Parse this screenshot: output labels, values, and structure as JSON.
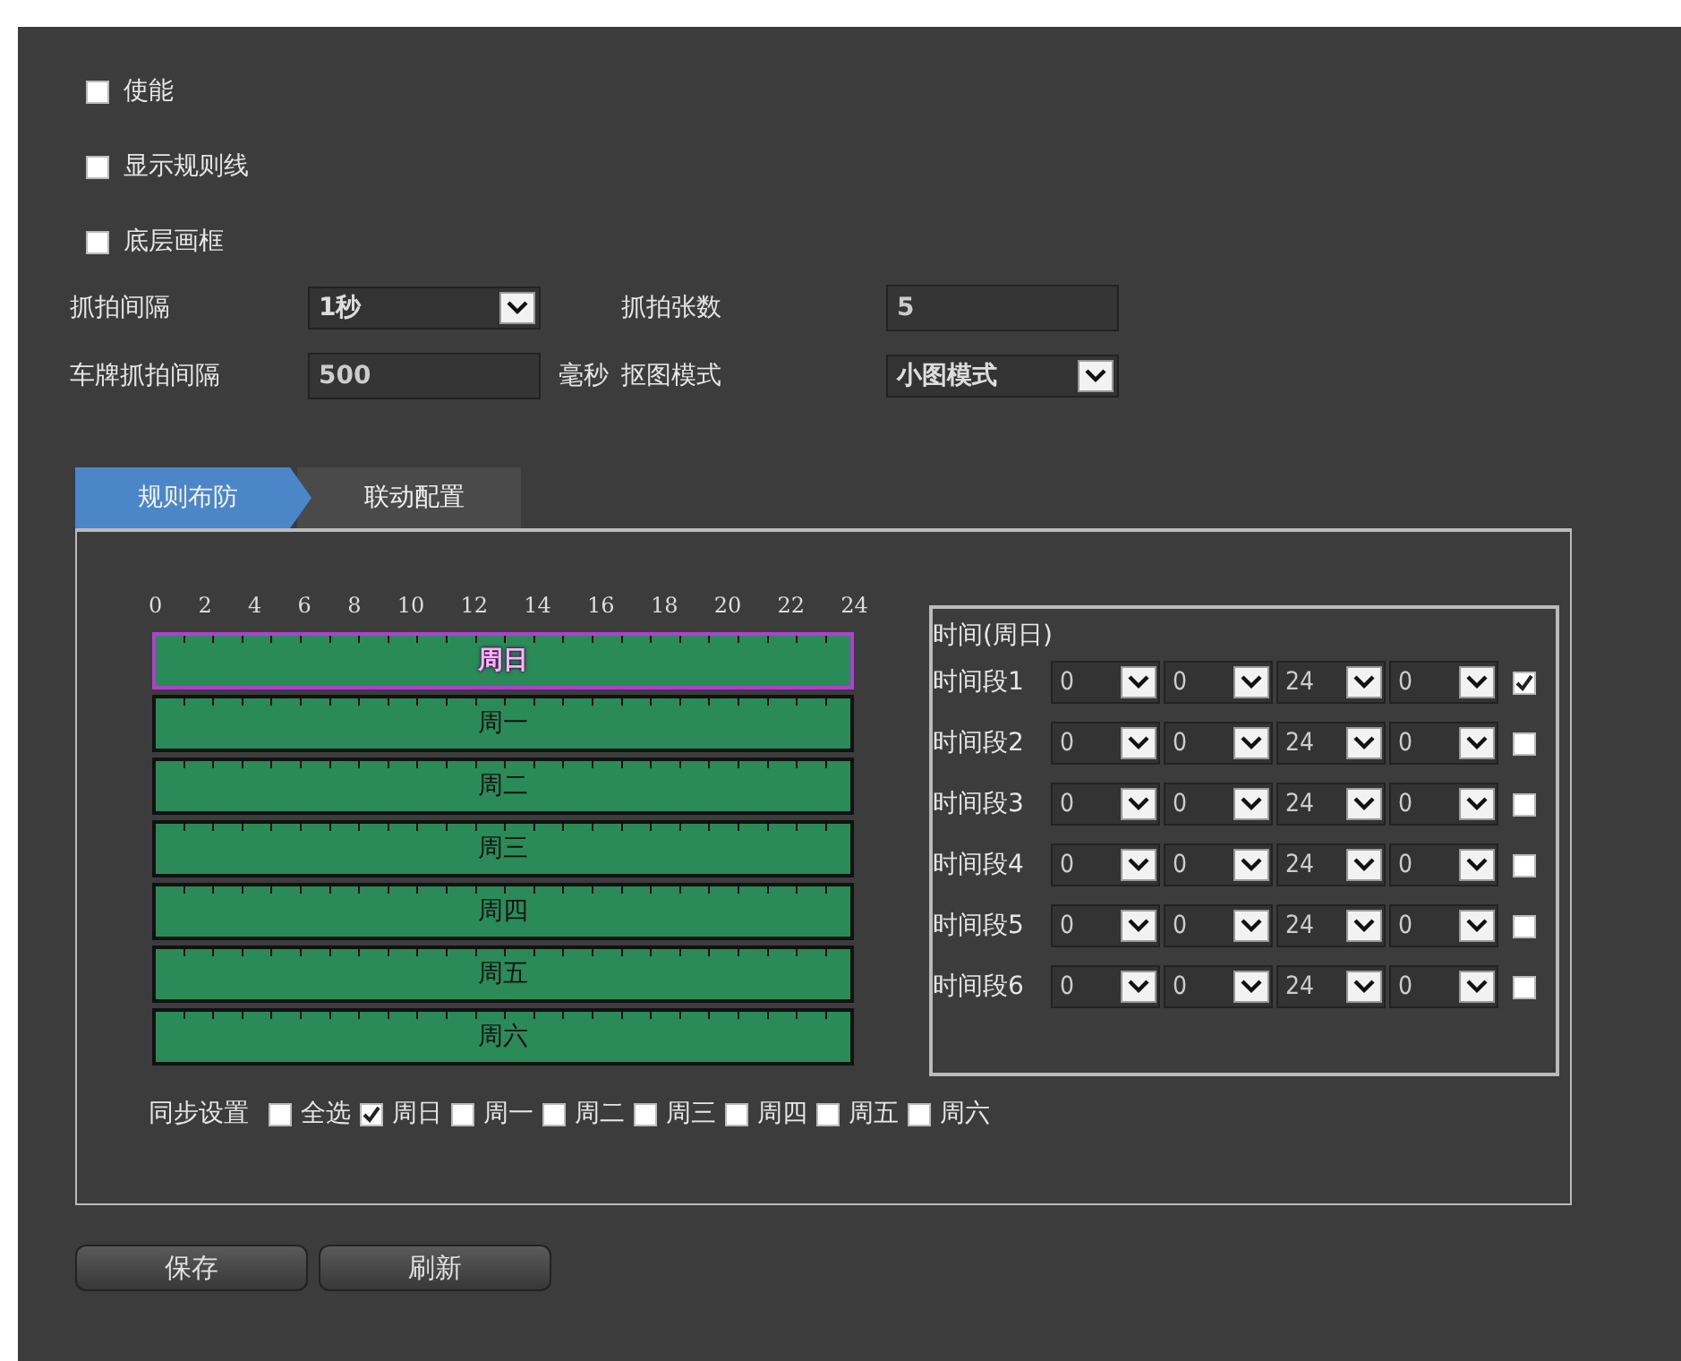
{
  "checkboxes": [
    {
      "label": "使能",
      "checked": false
    },
    {
      "label": "显示规则线",
      "checked": false
    },
    {
      "label": "底层画框",
      "checked": false
    }
  ],
  "settings": [
    {
      "kind": "select",
      "label": "抓拍间隔",
      "value": "1秒"
    },
    {
      "kind": "input",
      "label": "抓拍张数",
      "value": "5"
    },
    {
      "kind": "input",
      "label": "车牌抓拍间隔",
      "value": "500",
      "unit": "毫秒"
    },
    {
      "kind": "select",
      "label": "抠图模式",
      "value": "小图模式"
    }
  ],
  "tabs": [
    {
      "label": "规则布防",
      "selected": true
    },
    {
      "label": "联动配置",
      "selected": false
    }
  ],
  "schedule": {
    "hours": [
      "0",
      "2",
      "4",
      "6",
      "8",
      "10",
      "12",
      "14",
      "16",
      "18",
      "20",
      "22",
      "24"
    ],
    "days": [
      {
        "label": "周日",
        "selected": true
      },
      {
        "label": "周一",
        "selected": false
      },
      {
        "label": "周二",
        "selected": false
      },
      {
        "label": "周三",
        "selected": false
      },
      {
        "label": "周四",
        "selected": false
      },
      {
        "label": "周五",
        "selected": false
      },
      {
        "label": "周六",
        "selected": false
      }
    ],
    "time_panel": {
      "title": "时间(周日)",
      "periods": [
        {
          "label": "时间段1",
          "values": [
            "0",
            "0",
            "24",
            "0"
          ],
          "checked": true
        },
        {
          "label": "时间段2",
          "values": [
            "0",
            "0",
            "24",
            "0"
          ],
          "checked": false
        },
        {
          "label": "时间段3",
          "values": [
            "0",
            "0",
            "24",
            "0"
          ],
          "checked": false
        },
        {
          "label": "时间段4",
          "values": [
            "0",
            "0",
            "24",
            "0"
          ],
          "checked": false
        },
        {
          "label": "时间段5",
          "values": [
            "0",
            "0",
            "24",
            "0"
          ],
          "checked": false
        },
        {
          "label": "时间段6",
          "values": [
            "0",
            "0",
            "24",
            "0"
          ],
          "checked": false
        }
      ]
    },
    "sync": {
      "label": "同步设置",
      "options": [
        {
          "label": "全选",
          "checked": false
        },
        {
          "label": "周日",
          "checked": true
        },
        {
          "label": "周一",
          "checked": false
        },
        {
          "label": "周二",
          "checked": false
        },
        {
          "label": "周三",
          "checked": false
        },
        {
          "label": "周四",
          "checked": false
        },
        {
          "label": "周五",
          "checked": false
        },
        {
          "label": "周六",
          "checked": false
        }
      ]
    }
  },
  "buttons": [
    "保存",
    "刷新"
  ]
}
